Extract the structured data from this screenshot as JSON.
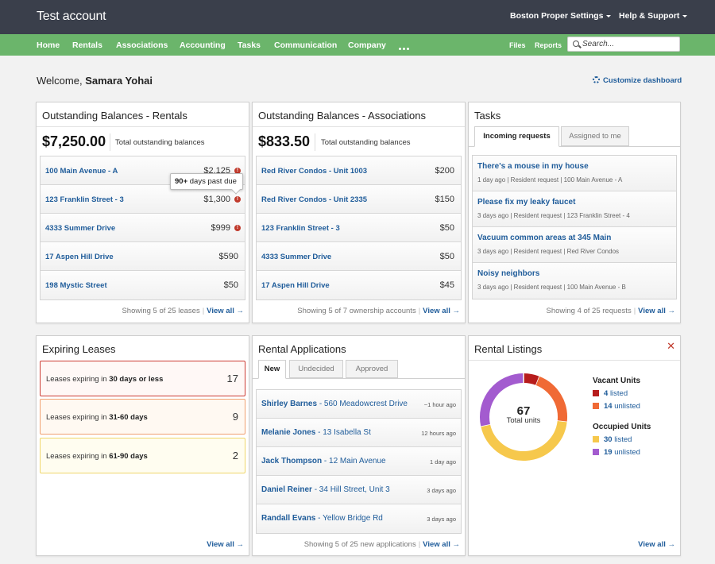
{
  "app": {
    "account": "Test account",
    "top_nav": [
      {
        "label": "Boston Proper"
      },
      {
        "label": "Settings"
      },
      {
        "label": "Help & Support"
      }
    ]
  },
  "nav": {
    "items": [
      "Home",
      "Rentals",
      "Associations",
      "Accounting",
      "Tasks",
      "Communication",
      "Company"
    ],
    "right": [
      "Files",
      "Reports"
    ],
    "search_placeholder": "Search..."
  },
  "welcome": {
    "prefix": "Welcome,",
    "name": "Samara Yohai",
    "customize": "Customize dashboard"
  },
  "rentals": {
    "title": "Outstanding Balances - Rentals",
    "total": "$7,250.00",
    "total_label": "Total outstanding balances",
    "rows": [
      {
        "name": "100 Main Avenue - A",
        "amount": "$2,125"
      },
      {
        "name": "123 Franklin Street - 3",
        "amount": "$1,300"
      },
      {
        "name": "4333 Summer Drive",
        "amount": "$999"
      },
      {
        "name": "17 Aspen Hill Drive",
        "amount": "$590"
      },
      {
        "name": "198 Mystic Street",
        "amount": "$50"
      }
    ],
    "tooltip_bold": "90+",
    "tooltip_rest": " days past due",
    "footer": "Showing 5 of 25 leases",
    "view_all": "View all →"
  },
  "associations": {
    "title": "Outstanding Balances - Associations",
    "total": "$833.50",
    "total_label": "Total outstanding balances",
    "rows": [
      {
        "name": "Red River Condos - Unit 1003",
        "amount": "$200"
      },
      {
        "name": "Red River Condos - Unit 2335",
        "amount": "$150"
      },
      {
        "name": "123 Franklin Street - 3",
        "amount": "$50"
      },
      {
        "name": "4333 Summer Drive",
        "amount": "$50"
      },
      {
        "name": "17 Aspen Hill Drive",
        "amount": "$45"
      }
    ],
    "footer": "Showing 5 of 7 ownership accounts",
    "view_all": "View all →"
  },
  "tasks": {
    "title": "Tasks",
    "tabs": [
      "Incoming requests",
      "Assigned to me"
    ],
    "rows": [
      {
        "title": "There's a mouse in my house",
        "meta": "1 day ago | Resident request | 100 Main Avenue - A"
      },
      {
        "title": "Please fix my leaky faucet",
        "meta": "3 days ago | Resident request | 123 Franklin Street - 4"
      },
      {
        "title": "Vacuum common areas at 345 Main",
        "meta": "3 days ago | Resident request | Red River Condos"
      },
      {
        "title": "Noisy neighbors",
        "meta": "3 days ago | Resident request | 100 Main Avenue - B"
      }
    ],
    "footer": "Showing 4 of 25 requests",
    "view_all": "View all →"
  },
  "expiring": {
    "title": "Expiring Leases",
    "rows": [
      {
        "prefix": "Leases expiring in ",
        "bold": "30 days or less",
        "count": "17"
      },
      {
        "prefix": "Leases expiring in ",
        "bold": "31-60 days",
        "count": "9"
      },
      {
        "prefix": "Leases expiring in ",
        "bold": "61-90 days",
        "count": "2"
      }
    ],
    "view_all": "View all →"
  },
  "applications": {
    "title": "Rental Applications",
    "tabs": [
      "New",
      "Undecided",
      "Approved"
    ],
    "rows": [
      {
        "name": "Shirley Barnes",
        "addr": " - 560 Meadowcrest Drive",
        "time": "~1 hour ago"
      },
      {
        "name": "Melanie Jones",
        "addr": " - 13 Isabella St",
        "time": "12 hours ago"
      },
      {
        "name": "Jack Thompson",
        "addr": " - 12 Main Avenue",
        "time": "1 day ago"
      },
      {
        "name": "Daniel Reiner",
        "addr": " - 34 Hill Street, Unit 3",
        "time": "3 days ago"
      },
      {
        "name": "Randall Evans",
        "addr": " - Yellow Bridge Rd",
        "time": "3 days ago"
      }
    ],
    "footer": "Showing 5 of 25 new applications",
    "view_all": "View all →"
  },
  "listings": {
    "title": "Rental Listings",
    "close": "✕",
    "total": "67",
    "total_label": "Total units",
    "vacant_heading": "Vacant Units",
    "occupied_heading": "Occupied Units",
    "segments": [
      {
        "group": "vacant",
        "count": "4",
        "label": "listed",
        "color": "#b71c1c",
        "value": 4
      },
      {
        "group": "vacant",
        "count": "14",
        "label": "unlisted",
        "color": "#f06a35",
        "value": 14
      },
      {
        "group": "occupied",
        "count": "30",
        "label": "listed",
        "color": "#f6c84c",
        "value": 30
      },
      {
        "group": "occupied",
        "count": "19",
        "label": "unlisted",
        "color": "#a35bcf",
        "value": 19
      }
    ],
    "view_all": "View all →"
  },
  "colors": {
    "topbar": "#3a3f4b",
    "nav": "#6bb56b",
    "link": "#1f5c9a",
    "alert": "#c0392b"
  }
}
